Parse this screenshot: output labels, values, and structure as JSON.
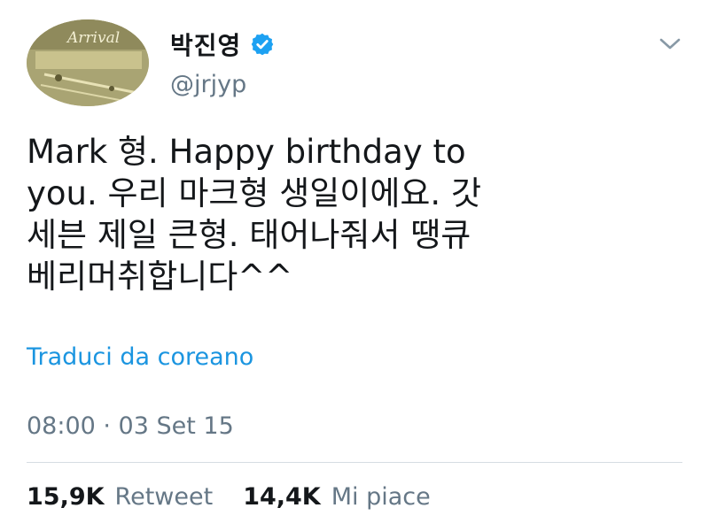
{
  "user": {
    "display_name": "박진영",
    "handle": "@jrjyp",
    "avatar_text": "Arrival",
    "verified": true
  },
  "tweet": {
    "lines": [
      "Mark 형. Happy birthday to",
      "you. 우리 마크형 생일이에요. 갓",
      "세븐 제일 큰형. 태어나줘서 땡큐",
      "베리머취합니다^^"
    ],
    "translate_label": "Traduci da coreano",
    "timestamp": "08:00 · 03 Set 15"
  },
  "stats": {
    "retweets_count": "15,9K",
    "retweets_label": "Retweet",
    "likes_count": "14,4K",
    "likes_label": "Mi piace"
  },
  "colors": {
    "link": "#1b95e0",
    "muted": "#657786",
    "verified": "#1da1f2",
    "text": "#14171a"
  },
  "icons": {
    "verified": "verified-badge-icon",
    "menu": "chevron-down-icon"
  }
}
